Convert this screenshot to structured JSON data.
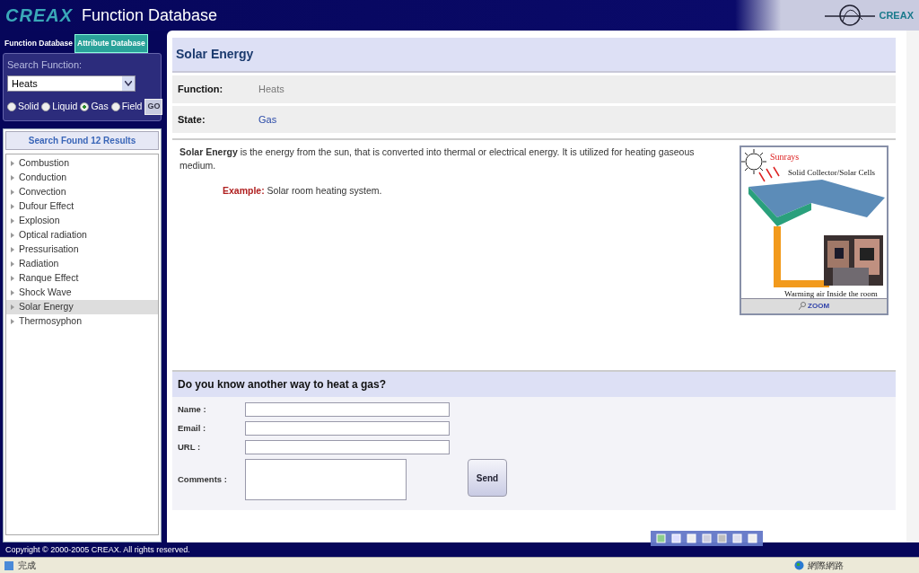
{
  "header": {
    "logo": "CREAX",
    "title": "Function Database",
    "corner_logo": "CREAX"
  },
  "tabs": [
    {
      "label": "Function Database",
      "selected": true
    },
    {
      "label": "Attribute Database",
      "selected": false
    }
  ],
  "search": {
    "label": "Search Function:",
    "value": "Heats",
    "go": "GO",
    "states": [
      {
        "label": "Solid",
        "selected": false
      },
      {
        "label": "Liquid",
        "selected": false
      },
      {
        "label": "Gas",
        "selected": true
      },
      {
        "label": "Field",
        "selected": false
      }
    ]
  },
  "results": {
    "title": "Search Found 12 Results",
    "items": [
      {
        "label": "Combustion",
        "selected": false
      },
      {
        "label": "Conduction",
        "selected": false
      },
      {
        "label": "Convection",
        "selected": false
      },
      {
        "label": "Dufour Effect",
        "selected": false
      },
      {
        "label": "Explosion",
        "selected": false
      },
      {
        "label": "Optical radiation",
        "selected": false
      },
      {
        "label": "Pressurisation",
        "selected": false
      },
      {
        "label": "Radiation",
        "selected": false
      },
      {
        "label": "Ranque Effect",
        "selected": false
      },
      {
        "label": "Shock Wave",
        "selected": false
      },
      {
        "label": "Solar Energy",
        "selected": true
      },
      {
        "label": "Thermosyphon",
        "selected": false
      }
    ]
  },
  "detail": {
    "title": "Solar Energy",
    "fields": [
      {
        "label": "Function:",
        "value": "Heats",
        "kind": "text"
      },
      {
        "label": "State:",
        "value": "Gas",
        "kind": "link"
      }
    ],
    "description": "**Solar Energy** is the energy from the sun, that is converted into thermal or electrical energy. It is utilized for heating gaseous medium.",
    "example_label": "Example:",
    "example_text": "Solar room heating system.",
    "figure": {
      "labels": [
        "Sunrays",
        "Solid Collector/Solar Cells",
        "Warming air Inside the room"
      ],
      "zoom": "ZOOM"
    }
  },
  "form": {
    "title": "Do you know another way to heat a gas?",
    "button": "Send",
    "fields": [
      {
        "label": "Name :",
        "kind": "input"
      },
      {
        "label": "Email :",
        "kind": "input"
      },
      {
        "label": "URL :",
        "kind": "input"
      },
      {
        "label": "Comments :",
        "kind": "textarea"
      }
    ]
  },
  "footer": "Copyright © 2000-2005 CREAX. All rights reserved.",
  "status_bar": {
    "text": "完成",
    "zone": "網際網路"
  }
}
